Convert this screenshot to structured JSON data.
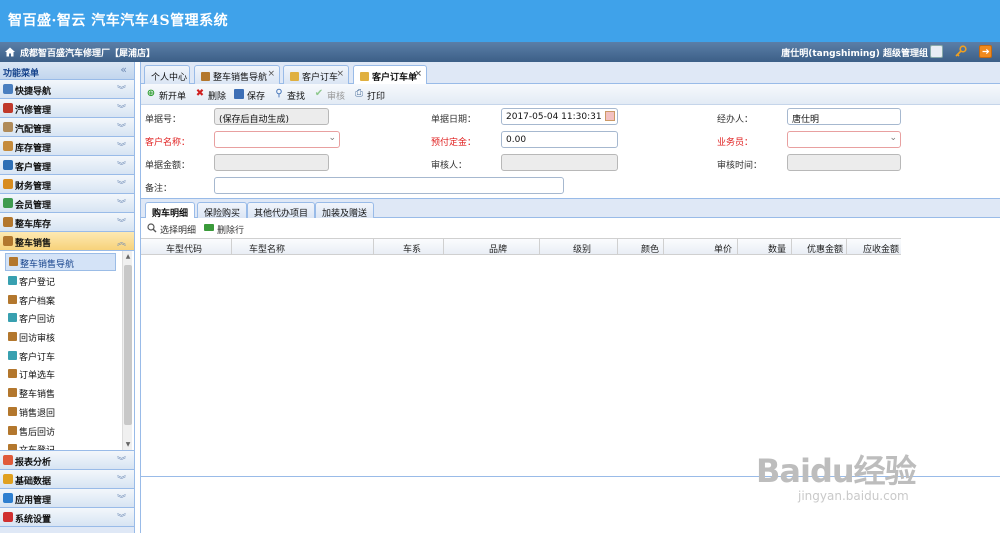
{
  "app": {
    "title": "智百盛·智云 汽车汽车4S管理系统"
  },
  "subbar": {
    "shop": "成都智百盛汽车修理厂【犀浦店】",
    "user": "唐仕明(tangshiming) 超级管理组"
  },
  "sidebar": {
    "header": "功能菜单",
    "collapse": "«",
    "groups_top": [
      {
        "label": "快捷导航",
        "color": "#4a7fc0"
      },
      {
        "label": "汽修管理",
        "color": "#c0392b"
      },
      {
        "label": "汽配管理",
        "color": "#b08b5a"
      },
      {
        "label": "库存管理",
        "color": "#c58b3c"
      },
      {
        "label": "客户管理",
        "color": "#2e6fb5"
      },
      {
        "label": "财务管理",
        "color": "#d88c1e"
      },
      {
        "label": "会员管理",
        "color": "#3e9b4f"
      },
      {
        "label": "整车库存",
        "color": "#b3772d"
      },
      {
        "label": "整车销售",
        "color": "#b3772d"
      }
    ],
    "sub_items": [
      {
        "label": "整车销售导航",
        "color": "#b3772d"
      },
      {
        "label": "客户登记",
        "color": "#38a0b0"
      },
      {
        "label": "客户档案",
        "color": "#b3772d"
      },
      {
        "label": "客户回访",
        "color": "#38a0b0"
      },
      {
        "label": "回访审核",
        "color": "#b3772d"
      },
      {
        "label": "客户订车",
        "color": "#38a0b0"
      },
      {
        "label": "订单选车",
        "color": "#b3772d"
      },
      {
        "label": "整车销售",
        "color": "#b3772d"
      },
      {
        "label": "销售退回",
        "color": "#b3772d"
      },
      {
        "label": "售后回访",
        "color": "#b3772d"
      },
      {
        "label": "文车登记",
        "color": "#b3772d"
      }
    ],
    "groups_bottom": [
      {
        "label": "报表分析",
        "color": "#e05a3a"
      },
      {
        "label": "基础数据",
        "color": "#e0a020"
      },
      {
        "label": "应用管理",
        "color": "#2e7fd0"
      },
      {
        "label": "系统设置",
        "color": "#d03030"
      }
    ]
  },
  "tabs": [
    {
      "label": "个人中心",
      "closable": false
    },
    {
      "label": "整车销售导航",
      "closable": true
    },
    {
      "label": "客户订车",
      "closable": true
    },
    {
      "label": "客户订车单",
      "closable": true
    }
  ],
  "toolbar": {
    "new": "新开单",
    "delete": "删除",
    "save": "保存",
    "find": "查找",
    "audit": "审核",
    "print": "打印"
  },
  "form": {
    "order_no_label": "单据号：",
    "order_no_value": "(保存后自动生成)",
    "order_date_label": "单据日期：",
    "order_date_value": "2017-05-04 11:30:31",
    "handler_label": "经办人：",
    "handler_value": "唐仕明",
    "customer_label": "客户名称：",
    "deposit_label": "预付定金：",
    "deposit_value": "0.00",
    "salesman_label": "业务员：",
    "amount_label": "单据金额：",
    "auditor_label": "审核人：",
    "audit_time_label": "审核时间：",
    "remark_label": "备注："
  },
  "detail_tabs": [
    "购车明细",
    "保险购买",
    "其他代办项目",
    "加装及赠送"
  ],
  "grid_toolbar": {
    "select": "选择明细",
    "delete_row": "删除行"
  },
  "grid_columns": [
    "车型代码",
    "车型名称",
    "车系",
    "品牌",
    "级别",
    "颜色",
    "单价",
    "数量",
    "优惠金额",
    "应收金额"
  ],
  "watermark": {
    "brand": "Baidu经验",
    "url": "jingyan.baidu.com"
  }
}
